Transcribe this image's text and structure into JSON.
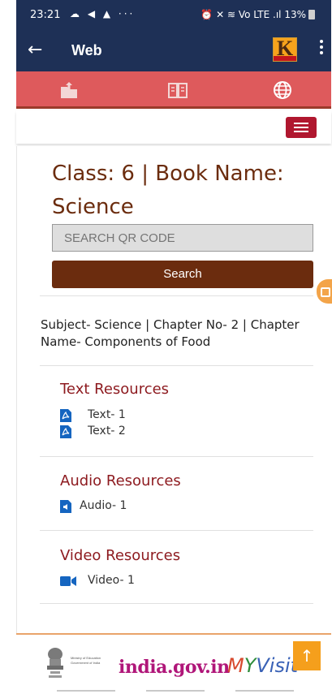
{
  "status_bar": {
    "time": "23:21",
    "left_icons": "☁ ◀ ▲ ···",
    "right_icons": "⏰ ✕ ≋ Vo LTE .ıl",
    "battery": "13%"
  },
  "app_bar": {
    "title": "Web",
    "back_icon": "arrow-left",
    "logo_letter": "K",
    "menu_icon": "more-vert"
  },
  "tabs": [
    {
      "icon": "upload-folder"
    },
    {
      "icon": "book"
    },
    {
      "icon": "globe"
    }
  ],
  "content": {
    "heading": "Class: 6 | Book Name: Science",
    "search": {
      "placeholder": "SEARCH QR CODE",
      "button_label": "Search"
    },
    "subject_line": "Subject- Science | Chapter No- 2 | Chapter Name- Components of Food",
    "sections": {
      "text": {
        "title": "Text Resources",
        "items": [
          "Text- 1",
          "Text- 2"
        ],
        "icon": "pdf-icon"
      },
      "audio": {
        "title": "Audio Resources",
        "items": [
          "Audio- 1"
        ],
        "icon": "audio-file-icon"
      },
      "video": {
        "title": "Video Resources",
        "items": [
          "Video- 1"
        ],
        "icon": "video-camera-icon"
      }
    }
  },
  "footer": {
    "ministry_text": "Ministry of Education Government of India",
    "india_gov": "india.gov.in",
    "myvisit_m": "M",
    "myvisit_y": "Y",
    "myvisit_rest": "Visit",
    "scroll_top": "↑"
  },
  "colors": {
    "app_bar": "#1e3056",
    "tab_bar": "#de5a5c",
    "heading": "#6b2c0e",
    "section_title": "#8d1a1f",
    "accent_orange": "#f59f1c"
  }
}
